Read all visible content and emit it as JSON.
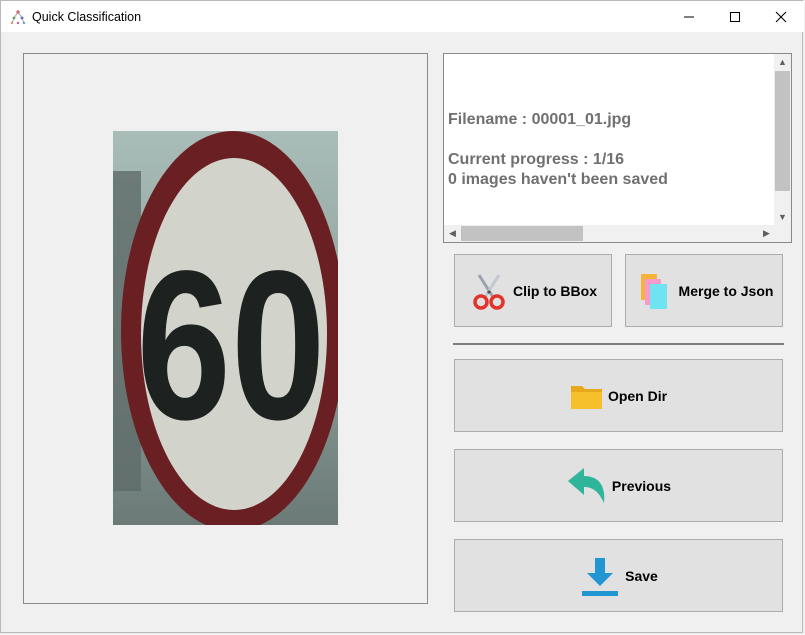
{
  "window": {
    "title": "Quick Classification"
  },
  "info": {
    "filename_line": "Filename : 00001_01.jpg",
    "progress_line": "Current progress : 1/16",
    "unsaved_line": "0 images haven't been saved"
  },
  "buttons": {
    "clip_label": "Clip to BBox",
    "merge_label": "Merge to Json",
    "open_label": "Open Dir",
    "previous_label": "Previous",
    "save_label": "Save"
  },
  "icons": {
    "clip": "scissors-icon",
    "merge": "documents-icon",
    "open": "folder-icon",
    "previous": "back-arrow-icon",
    "save": "download-icon"
  },
  "sign": {
    "text": "60"
  },
  "colors": {
    "info_text": "#707070",
    "button_bg": "#e1e1e1",
    "scissors_red": "#e0342b",
    "folder_yellow": "#f6c02c",
    "back_arrow_teal": "#2fb69a",
    "save_blue": "#2196d3"
  }
}
